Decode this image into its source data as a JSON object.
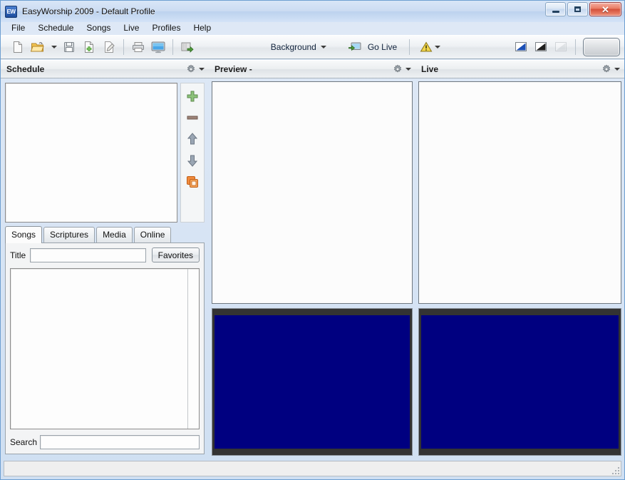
{
  "window": {
    "title": "EasyWorship 2009 - Default Profile",
    "app_icon": "ew-app-icon",
    "controls": {
      "minimize": "minimize-button",
      "maximize": "maximize-button",
      "close_glyph": "✕"
    }
  },
  "menubar": {
    "items": [
      {
        "label": "File"
      },
      {
        "label": "Schedule"
      },
      {
        "label": "Songs"
      },
      {
        "label": "Live"
      },
      {
        "label": "Profiles"
      },
      {
        "label": "Help"
      }
    ]
  },
  "toolbar": {
    "buttons": [
      {
        "name": "new-schedule",
        "icon": "new-document-icon",
        "tooltip": "New"
      },
      {
        "name": "open-schedule",
        "icon": "open-folder-icon",
        "tooltip": "Open"
      },
      {
        "name": "open-dropdown",
        "icon": "chevron-down-icon",
        "tooltip": "Open recent"
      },
      {
        "name": "save-schedule",
        "icon": "save-floppy-icon",
        "tooltip": "Save"
      },
      {
        "name": "add-item",
        "icon": "document-add-icon",
        "tooltip": "Add"
      },
      {
        "name": "edit-item",
        "icon": "edit-pencil-icon",
        "tooltip": "Edit"
      },
      {
        "name": "print",
        "icon": "printer-icon",
        "tooltip": "Print"
      },
      {
        "name": "display",
        "icon": "monitor-icon",
        "tooltip": "Display"
      },
      {
        "name": "export",
        "icon": "export-arrow-icon",
        "tooltip": "Export"
      }
    ],
    "background_label": "Background",
    "go_live_label": "Go Live",
    "go_live_icon": "go-live-screen-icon",
    "alert_icon": "warning-triangle-icon",
    "view_buttons": [
      {
        "name": "view-blue",
        "icon": "blue-slide-icon"
      },
      {
        "name": "view-black",
        "icon": "black-slide-icon"
      },
      {
        "name": "view-clear",
        "icon": "clear-slide-icon"
      }
    ],
    "logo_button": "logo-button"
  },
  "panels": {
    "schedule": {
      "title": "Schedule",
      "gear_icon": "gear-icon",
      "caret_icon": "chevron-down-icon",
      "tools": [
        {
          "name": "add-schedule-item",
          "icon": "plus-icon"
        },
        {
          "name": "remove-schedule-item",
          "icon": "minus-icon"
        },
        {
          "name": "move-item-up",
          "icon": "arrow-up-icon"
        },
        {
          "name": "move-item-down",
          "icon": "arrow-down-icon"
        },
        {
          "name": "duplicate-item",
          "icon": "copy-icon"
        }
      ],
      "items": []
    },
    "preview": {
      "title": "Preview -",
      "gear_icon": "gear-icon",
      "caret_icon": "chevron-down-icon",
      "slide_color": "#000080",
      "letterbox_color": "#333333"
    },
    "live": {
      "title": "Live",
      "gear_icon": "gear-icon",
      "caret_icon": "chevron-down-icon",
      "slide_color": "#000080",
      "letterbox_color": "#333333"
    }
  },
  "resource_tabs": {
    "items": [
      {
        "label": "Songs",
        "active": true
      },
      {
        "label": "Scriptures",
        "active": false
      },
      {
        "label": "Media",
        "active": false
      },
      {
        "label": "Online",
        "active": false
      }
    ],
    "title_label": "Title",
    "title_value": "",
    "title_placeholder": "",
    "favorites_label": "Favorites",
    "search_label": "Search",
    "search_value": "",
    "search_placeholder": "",
    "song_results": []
  },
  "statusbar": {
    "text": "",
    "grip_icon": "resize-grip-icon"
  },
  "colors": {
    "slide_navy": "#000080",
    "letterbox": "#333333",
    "window_frame": "#6e9fd1",
    "accent_blue": "#1c4c9c"
  }
}
